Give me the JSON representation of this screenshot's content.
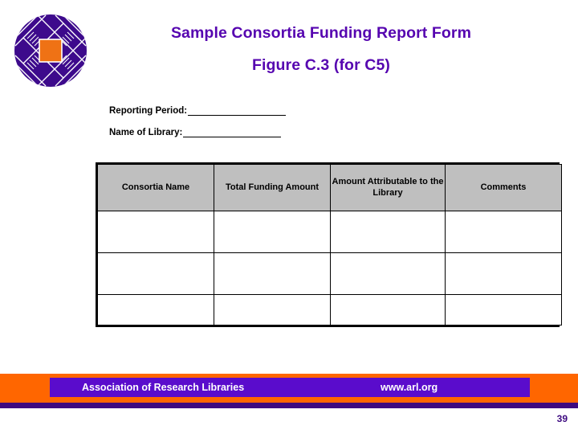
{
  "slide": {
    "title": "Sample Consortia Funding Report Form",
    "subtitle": "Figure C.3 (for C5)",
    "page_number": "39"
  },
  "logo": {
    "name": "arl-logo",
    "circle_color": "#3d0a8c",
    "square_color": "#ef7215",
    "line_color": "#ffffff"
  },
  "form": {
    "fields": [
      {
        "label": "Reporting Period:",
        "value": ""
      },
      {
        "label": "Name of Library:",
        "value": ""
      }
    ]
  },
  "table": {
    "headers": [
      "Consortia Name",
      "Total Funding Amount",
      "Amount Attributable to the Library",
      "Comments"
    ],
    "rows": [
      [
        "",
        "",
        "",
        ""
      ],
      [
        "",
        "",
        "",
        ""
      ],
      [
        "",
        "",
        "",
        ""
      ]
    ],
    "header_bg": "#bfbfbf"
  },
  "footer": {
    "organization": "Association of Research Libraries",
    "url": "www.arl.org",
    "bar_color": "#ff6600",
    "inner_bar_color": "#5a0ccc",
    "rule_color": "#3d0a80"
  },
  "colors": {
    "title_purple": "#5605b0",
    "orange": "#ff6600",
    "purple": "#3d0a80"
  }
}
